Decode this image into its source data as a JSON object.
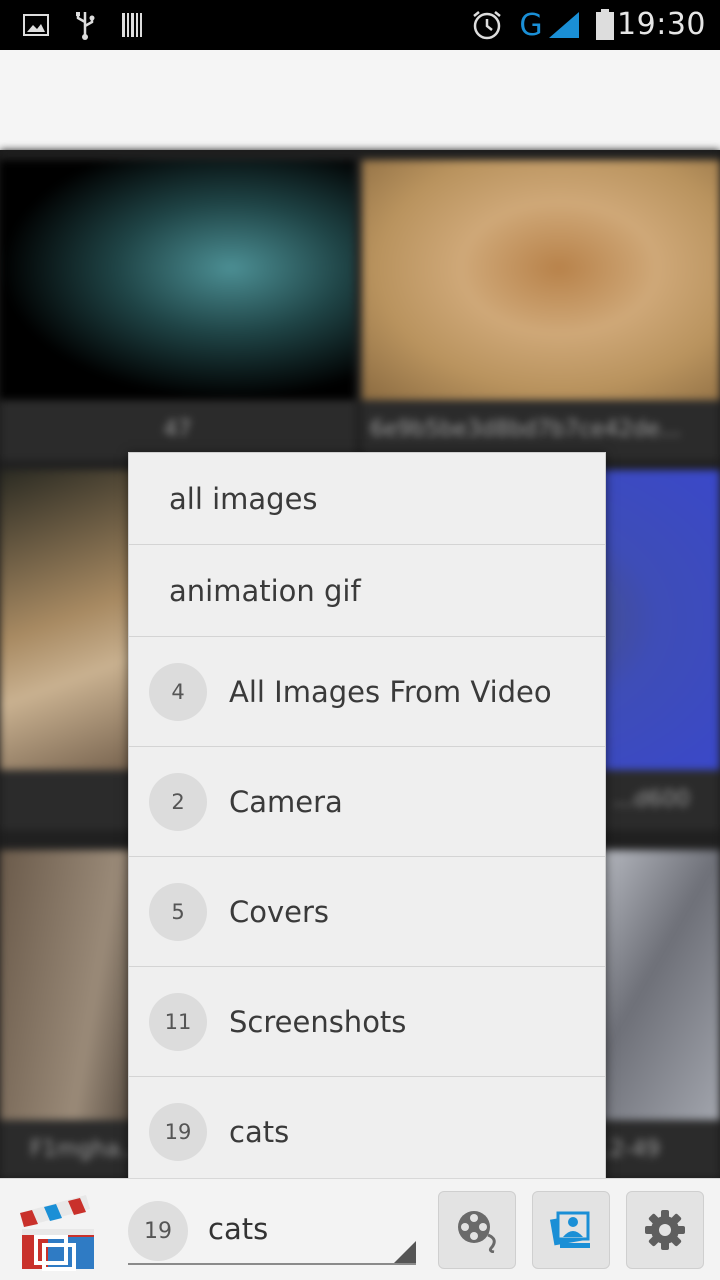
{
  "status_bar": {
    "time": "19:30",
    "network": "G",
    "icons": [
      "image-icon",
      "usb-icon",
      "barcode-icon",
      "alarm-icon",
      "signal-icon",
      "battery-icon"
    ]
  },
  "grid": {
    "captions": [
      "47",
      "6e9b5be3d8bd7b7ce42de...",
      "",
      "...d600",
      "F1mgha...",
      "...2-49"
    ]
  },
  "dropdown": {
    "plain_items": [
      {
        "label": "all images"
      },
      {
        "label": "animation gif"
      }
    ],
    "albums": [
      {
        "count": "4",
        "label": "All Images From Video"
      },
      {
        "count": "2",
        "label": "Camera"
      },
      {
        "count": "5",
        "label": "Covers"
      },
      {
        "count": "11",
        "label": "Screenshots"
      },
      {
        "count": "19",
        "label": "cats"
      }
    ]
  },
  "bottom_bar": {
    "selected_album": {
      "count": "19",
      "label": "cats"
    },
    "buttons": [
      "film-reel-icon",
      "gallery-icon",
      "gear-icon"
    ]
  },
  "colors": {
    "accent_blue": "#1a8fd6",
    "logo_red": "#c9312b"
  }
}
